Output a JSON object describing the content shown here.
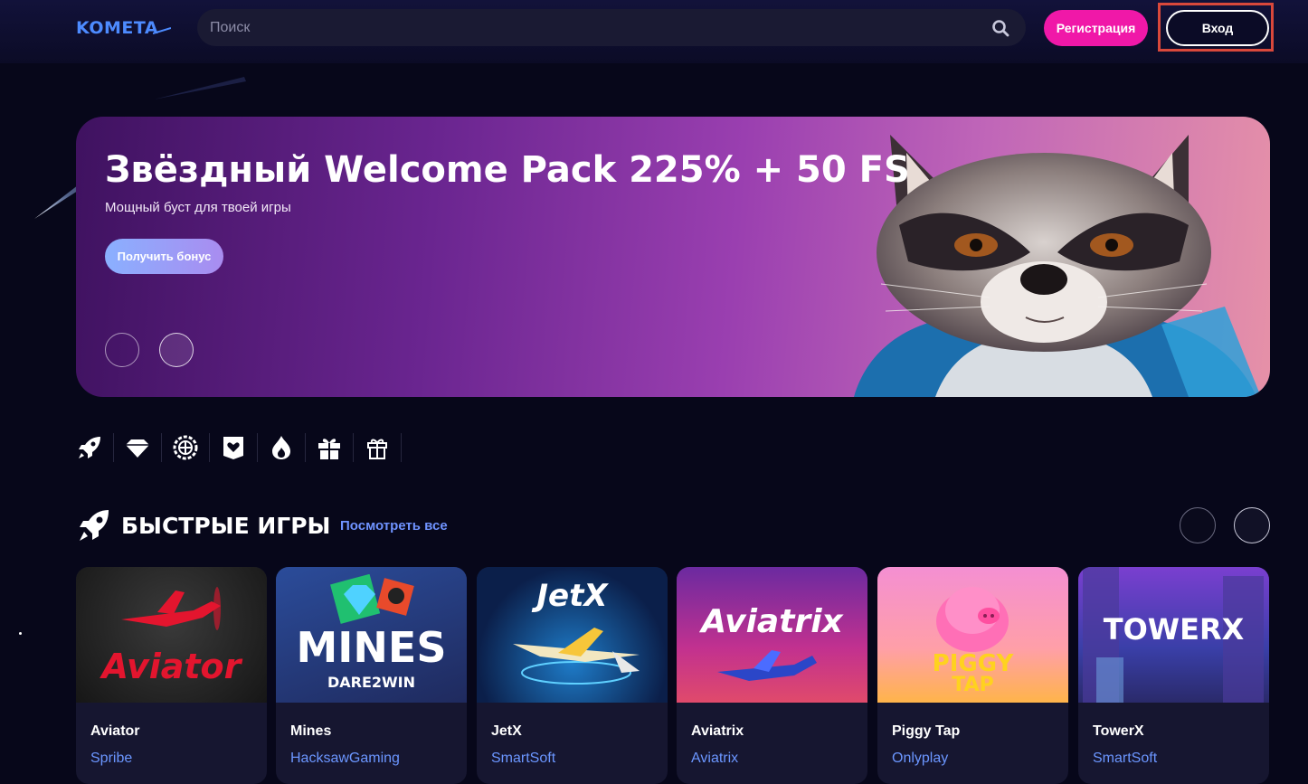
{
  "header": {
    "logo": "KOMETA",
    "search_placeholder": "Поиск",
    "register_label": "Регистрация",
    "login_label": "Вход"
  },
  "banner": {
    "title": "Звёздный Welcome Pack 225% + 50 FS",
    "subtitle": "Мощный буст для твоей игры",
    "cta": "Получить бонус"
  },
  "categories": [
    "rocket-icon",
    "diamond-icon",
    "roulette-icon",
    "heart-card-icon",
    "fire-icon",
    "gift-box-icon",
    "gift-outline-icon"
  ],
  "section": {
    "title": "БЫСТРЫЕ ИГРЫ",
    "view_all": "Посмотреть все"
  },
  "games": [
    {
      "name": "Aviator",
      "provider": "Spribe",
      "logo": "Aviator"
    },
    {
      "name": "Mines",
      "provider": "HacksawGaming",
      "logo": "MINES",
      "logo_sub": "DARE2WIN"
    },
    {
      "name": "JetX",
      "provider": "SmartSoft",
      "logo": "JetX"
    },
    {
      "name": "Aviatrix",
      "provider": "Aviatrix",
      "logo": "Aviatrix"
    },
    {
      "name": "Piggy Tap",
      "provider": "Onlyplay",
      "logo": "PIGGY",
      "logo_sub": "TAP"
    },
    {
      "name": "TowerX",
      "provider": "SmartSoft",
      "logo": "TOWERX"
    }
  ],
  "colors": {
    "accent_pink": "#f018a8",
    "link_blue": "#6f93ff",
    "highlight_red": "#d9483b",
    "background": "#07071a"
  }
}
